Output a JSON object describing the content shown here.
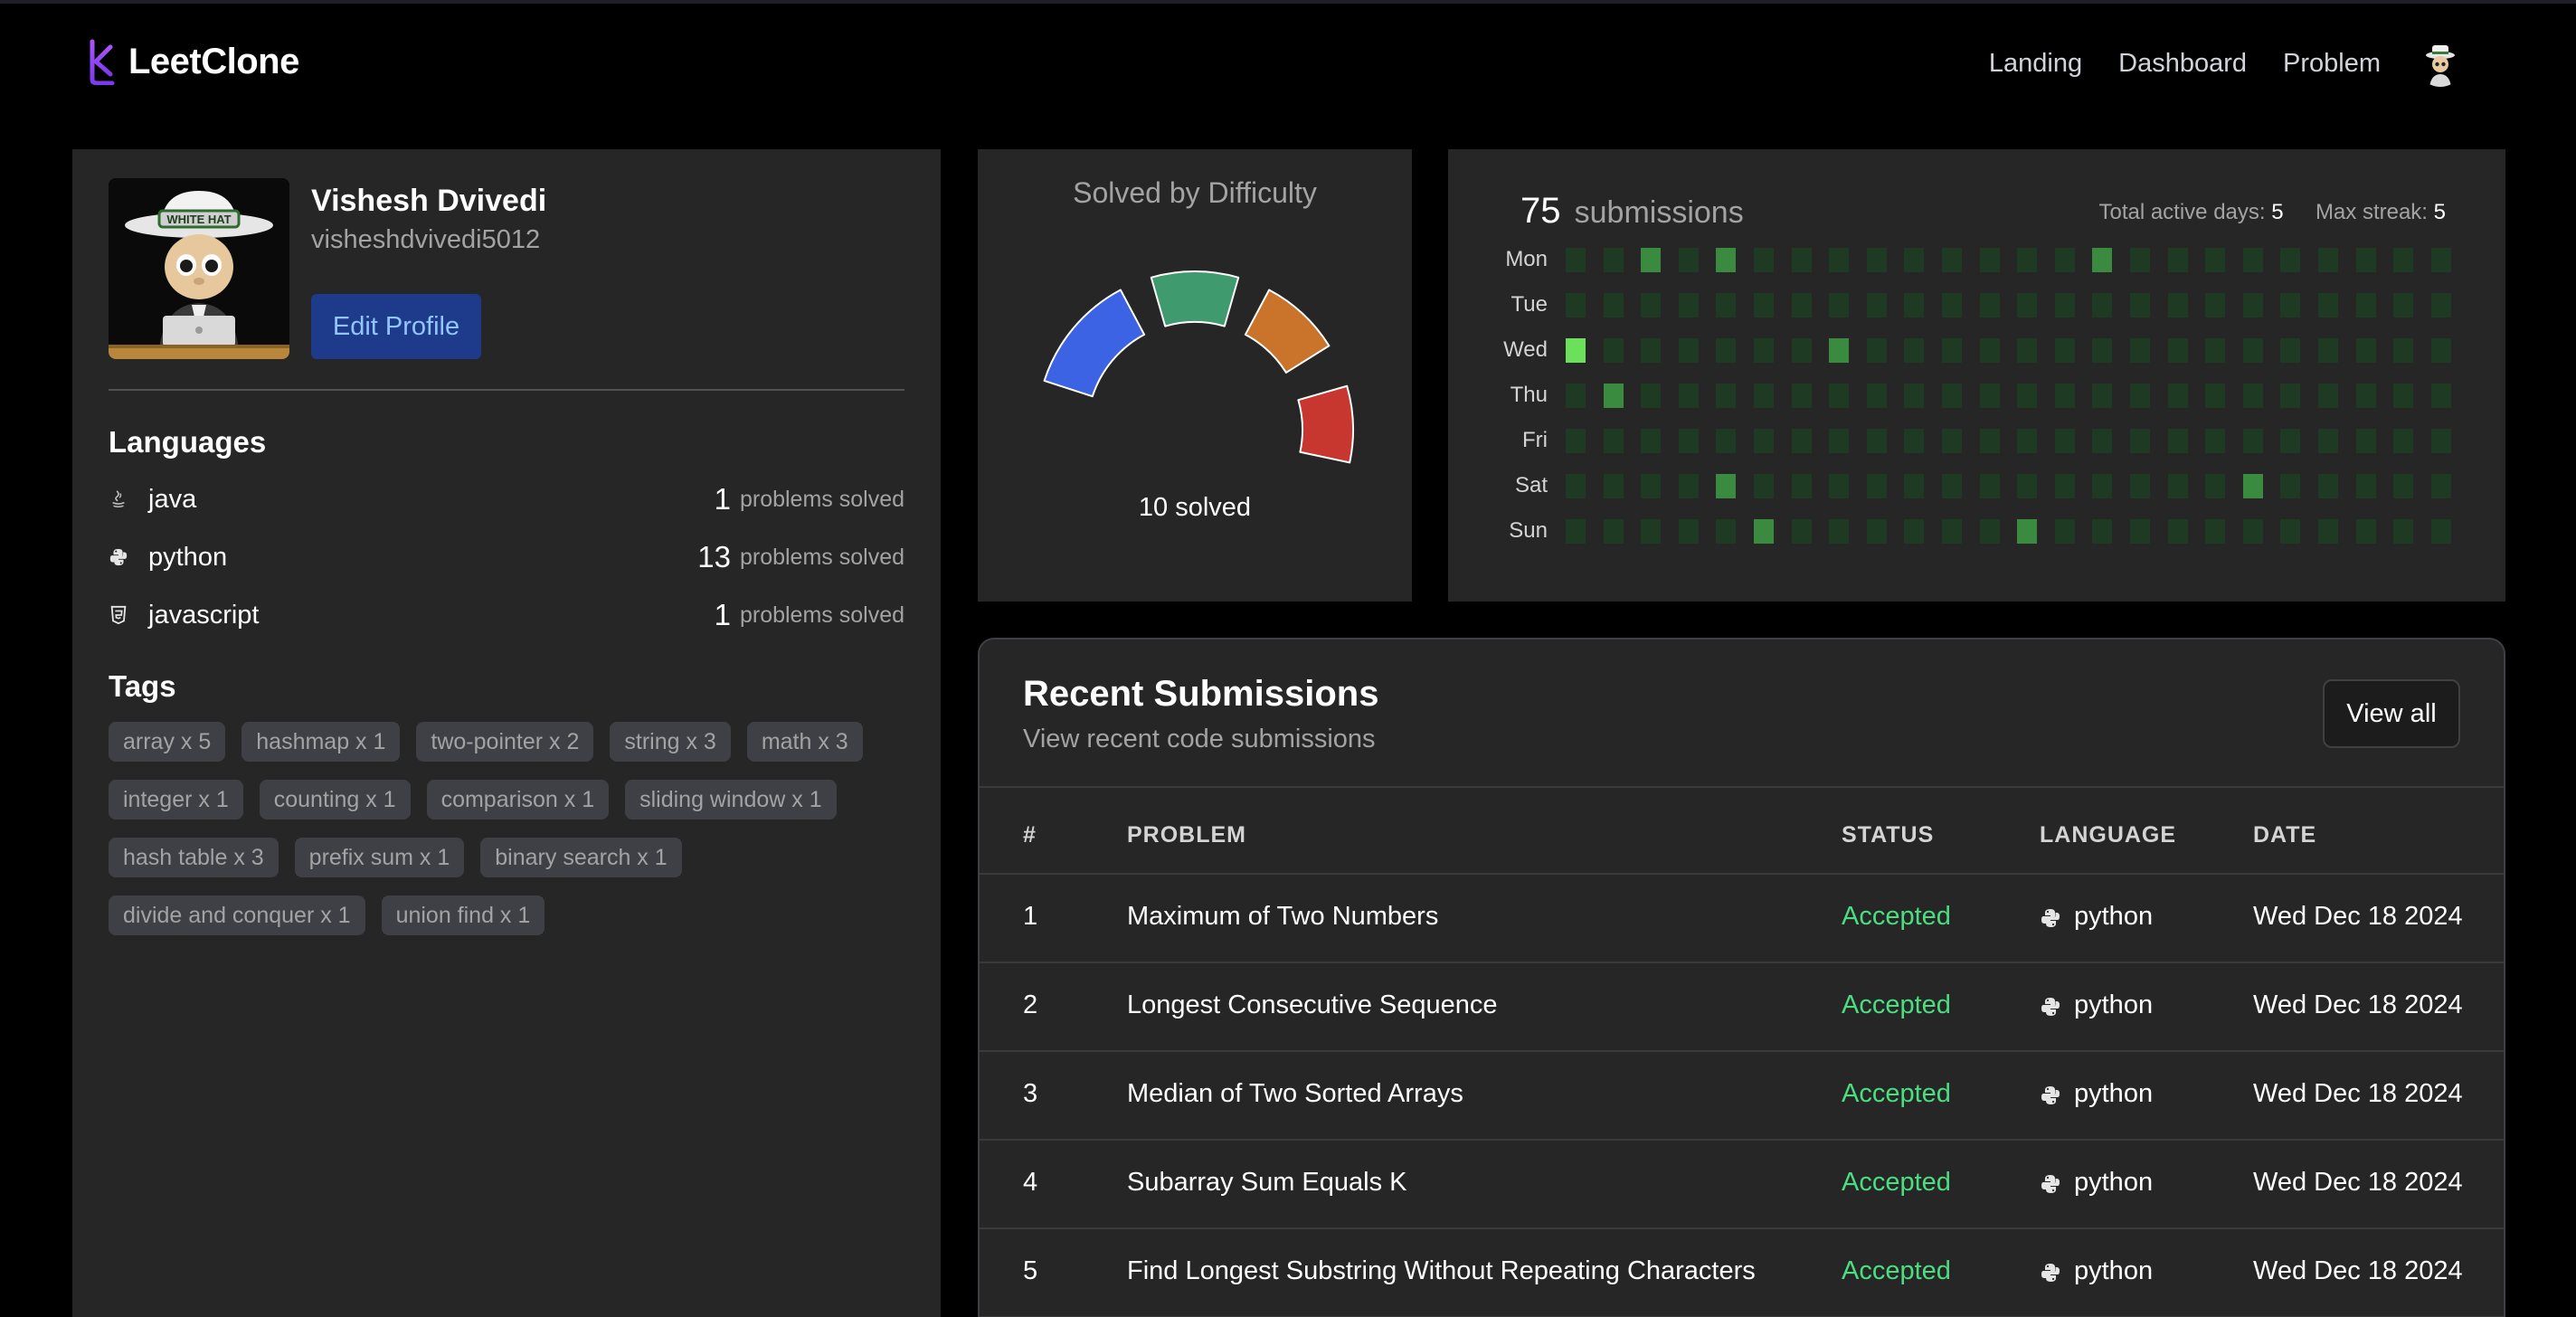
{
  "header": {
    "brand": "LeetClone",
    "nav": [
      "Landing",
      "Dashboard",
      "Problem"
    ]
  },
  "profile": {
    "name": "Vishesh Dvivedi",
    "username": "visheshdvivedi5012",
    "edit_label": "Edit Profile",
    "avatar_badge_text": "WHITE HAT"
  },
  "languages": {
    "title": "Languages",
    "suffix": "problems solved",
    "items": [
      {
        "name": "java",
        "count": "1",
        "icon": "java-icon"
      },
      {
        "name": "python",
        "count": "13",
        "icon": "python-icon"
      },
      {
        "name": "javascript",
        "count": "1",
        "icon": "html5-icon"
      }
    ]
  },
  "tags": {
    "title": "Tags",
    "items": [
      "array x 5",
      "hashmap x 1",
      "two-pointer x 2",
      "string x 3",
      "math x 3",
      "integer x 1",
      "counting x 1",
      "comparison x 1",
      "sliding window x 1",
      "hash table x 3",
      "prefix sum x 1",
      "binary search x 1",
      "divide and conquer x 1",
      "union find x 1"
    ]
  },
  "difficulty": {
    "title": "Solved by Difficulty",
    "solved_text": "10 solved",
    "colors": {
      "blue": "#3b63e3",
      "green": "#3f9a6e",
      "orange": "#c9742a",
      "red": "#c8372f"
    }
  },
  "heatmap": {
    "count": "75",
    "count_label": "submissions",
    "active_days_label": "Total active days:",
    "active_days": "5",
    "max_streak_label": "Max streak:",
    "max_streak": "5",
    "days": [
      "Mon",
      "Tue",
      "Wed",
      "Thu",
      "Fri",
      "Sat",
      "Sun"
    ],
    "weeks": 24,
    "levels": {
      "Mon": {
        "2": 2,
        "4": 2,
        "14": 2
      },
      "Wed": {
        "0": 4,
        "7": 2
      },
      "Thu": {
        "1": 2
      },
      "Sat": {
        "4": 2,
        "18": 2
      },
      "Sun": {
        "5": 2,
        "12": 2
      }
    },
    "colors": {
      "0": "#1f3a22",
      "2": "#3a8a3f",
      "4": "#6be05a"
    }
  },
  "submissions": {
    "title": "Recent Submissions",
    "subtitle": "View recent code submissions",
    "view_all": "View all",
    "columns": [
      "#",
      "PROBLEM",
      "STATUS",
      "LANGUAGE",
      "DATE"
    ],
    "rows": [
      {
        "num": "1",
        "problem": "Maximum of Two Numbers",
        "status": "Accepted",
        "language": "python",
        "date": "Wed Dec 18 2024"
      },
      {
        "num": "2",
        "problem": "Longest Consecutive Sequence",
        "status": "Accepted",
        "language": "python",
        "date": "Wed Dec 18 2024"
      },
      {
        "num": "3",
        "problem": "Median of Two Sorted Arrays",
        "status": "Accepted",
        "language": "python",
        "date": "Wed Dec 18 2024"
      },
      {
        "num": "4",
        "problem": "Subarray Sum Equals K",
        "status": "Accepted",
        "language": "python",
        "date": "Wed Dec 18 2024"
      },
      {
        "num": "5",
        "problem": "Find Longest Substring Without Repeating Characters",
        "status": "Accepted",
        "language": "python",
        "date": "Wed Dec 18 2024"
      }
    ]
  }
}
